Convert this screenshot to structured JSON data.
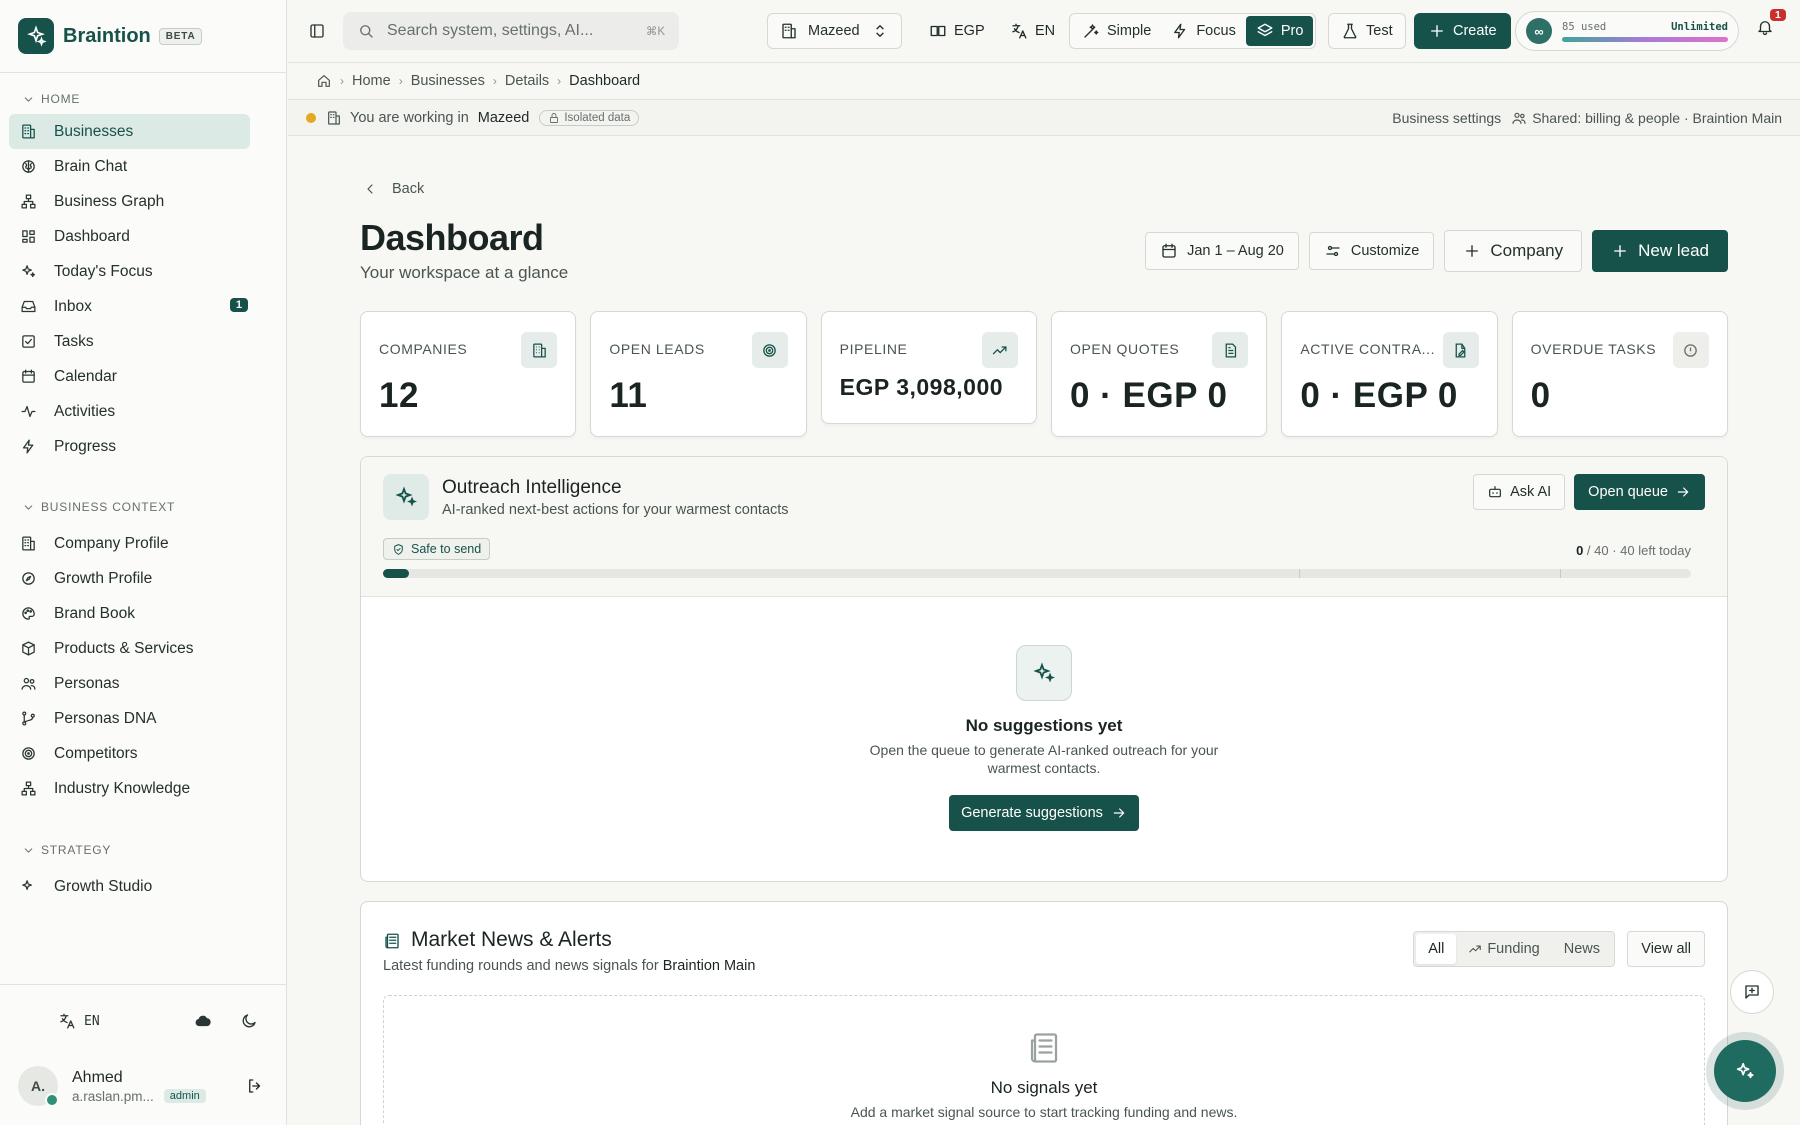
{
  "brand": {
    "name": "Braintion",
    "badge": "BETA"
  },
  "topbar": {
    "search_placeholder": "Search system, settings, AI...",
    "search_shortcut": "⌘K",
    "workspace": "Mazeed",
    "currency": "EGP",
    "language": "EN",
    "modes": [
      "Simple",
      "Focus",
      "Pro"
    ],
    "active_mode": "Pro",
    "test_label": "Test",
    "create_label": "Create",
    "usage_used": "85 used",
    "usage_limit": "Unlimited",
    "usage_icon": "∞",
    "notifications": "1"
  },
  "breadcrumb": [
    "Home",
    "Businesses",
    "Details",
    "Dashboard"
  ],
  "context": {
    "prefix": "You are working in",
    "workspace": "Mazeed",
    "isolation": "Isolated data",
    "settings_link": "Business settings",
    "shared_text": "Shared: billing & people · Braintion Main"
  },
  "sidebar": {
    "sections": [
      {
        "title": "HOME",
        "items": [
          {
            "label": "Businesses",
            "icon": "building-icon",
            "active": true
          },
          {
            "label": "Brain Chat",
            "icon": "brain-icon"
          },
          {
            "label": "Business Graph",
            "icon": "graph-icon"
          },
          {
            "label": "Dashboard",
            "icon": "dashboard-icon"
          },
          {
            "label": "Today's Focus",
            "icon": "sparkle-icon"
          },
          {
            "label": "Inbox",
            "icon": "inbox-icon",
            "badge": "1"
          },
          {
            "label": "Tasks",
            "icon": "tasks-icon"
          },
          {
            "label": "Calendar",
            "icon": "calendar-icon"
          },
          {
            "label": "Activities",
            "icon": "activity-icon"
          },
          {
            "label": "Progress",
            "icon": "bolt-icon"
          }
        ]
      },
      {
        "title": "BUSINESS CONTEXT",
        "items": [
          {
            "label": "Company Profile",
            "icon": "building-icon"
          },
          {
            "label": "Growth Profile",
            "icon": "compass-icon"
          },
          {
            "label": "Brand Book",
            "icon": "palette-icon"
          },
          {
            "label": "Products & Services",
            "icon": "box-icon"
          },
          {
            "label": "Personas",
            "icon": "users-icon"
          },
          {
            "label": "Personas DNA",
            "icon": "branch-icon"
          },
          {
            "label": "Competitors",
            "icon": "target-icon"
          },
          {
            "label": "Industry Knowledge",
            "icon": "network-icon"
          }
        ]
      },
      {
        "title": "STRATEGY",
        "items": [
          {
            "label": "Growth Studio",
            "icon": "sparkle-icon"
          }
        ]
      }
    ],
    "bottom": {
      "language": "EN",
      "user_initials": "A.",
      "user_name": "Ahmed",
      "user_email": "a.raslan.pm...",
      "role": "admin"
    }
  },
  "page": {
    "back_label": "Back",
    "title": "Dashboard",
    "subtitle": "Your workspace at a glance",
    "date_range": "Jan 1 – Aug 20",
    "customize_label": "Customize",
    "company_label": "Company",
    "new_lead_label": "New lead"
  },
  "stats": [
    {
      "label": "COMPANIES",
      "value": "12",
      "icon": "building-icon"
    },
    {
      "label": "OPEN LEADS",
      "value": "11",
      "icon": "target-icon"
    },
    {
      "label": "PIPELINE",
      "value": "EGP 3,098,000",
      "icon": "trending-up-icon"
    },
    {
      "label": "OPEN QUOTES",
      "value": "0 · EGP 0",
      "icon": "document-icon"
    },
    {
      "label": "ACTIVE CONTRA...",
      "value": "0 · EGP 0",
      "icon": "contract-icon"
    },
    {
      "label": "OVERDUE TASKS",
      "value": "0",
      "icon": "alert-icon"
    }
  ],
  "outreach": {
    "title": "Outreach Intelligence",
    "subtitle": "AI-ranked next-best actions for your warmest contacts",
    "ask_ai_label": "Ask AI",
    "open_queue_label": "Open queue",
    "safe_label": "Safe to send",
    "quota_used": "0",
    "quota_rest": "/ 40 · 40 left today",
    "progress_fraction": 0.02,
    "empty_title": "No suggestions yet",
    "empty_text": "Open the queue to generate AI-ranked outreach for your warmest contacts.",
    "generate_label": "Generate suggestions"
  },
  "news": {
    "title": "Market News & Alerts",
    "subtitle_prefix": "Latest funding rounds and news signals for",
    "subtitle_entity": "Braintion Main",
    "filters": [
      "All",
      "Funding",
      "News"
    ],
    "active_filter": "All",
    "view_all_label": "View all",
    "empty_title": "No signals yet",
    "empty_text": "Add a market signal source to start tracking funding and news."
  },
  "colors": {
    "accent": "#17524a",
    "warning_dot": "#e5a822",
    "notification": "#c9302c"
  }
}
